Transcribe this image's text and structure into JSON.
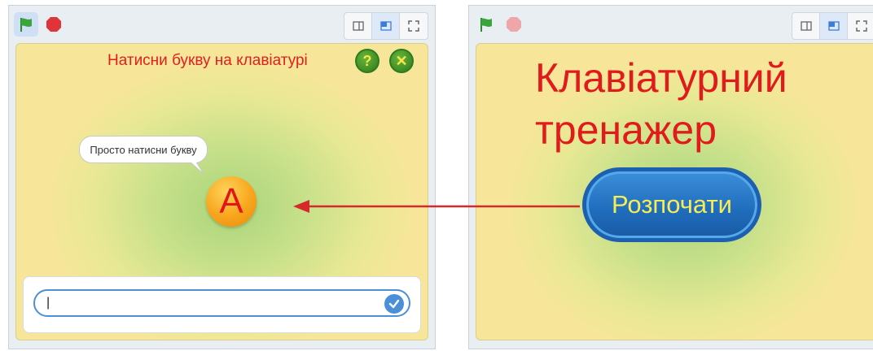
{
  "left_window": {
    "toolbar": {
      "green_flag_icon": "green-flag-icon",
      "stop_icon": "stop-sign-icon",
      "views": [
        "small-stage-icon",
        "normal-stage-icon",
        "fullscreen-icon"
      ]
    },
    "stage": {
      "prompt_text": "Натисни букву на клавіатурі",
      "help_glyph": "?",
      "close_glyph": "✕",
      "speech_bubble": "Просто натисни букву",
      "letter": "А"
    },
    "ask_box": {
      "value": "|"
    }
  },
  "right_window": {
    "toolbar": {
      "green_flag_icon": "green-flag-icon",
      "stop_icon": "stop-sign-icon",
      "views": [
        "small-stage-icon",
        "normal-stage-icon",
        "fullscreen-icon"
      ]
    },
    "stage": {
      "title_line1": "Клавіатурний",
      "title_line2": "тренажер",
      "start_button": "Розпочати"
    }
  },
  "colors": {
    "title_red": "#e11b1b",
    "button_blue": "#1f6cbc",
    "button_text": "#f6ec55",
    "arrow_red": "#d42a2a",
    "flag_green": "#3aa53a",
    "stop_red": "#e0343a"
  }
}
